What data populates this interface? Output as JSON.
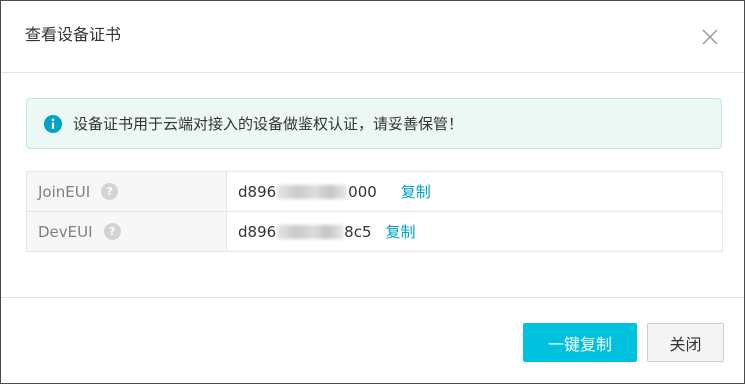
{
  "dialog": {
    "title": "查看设备证书",
    "close_icon": "close-icon"
  },
  "alert": {
    "icon": "info-icon",
    "text": "设备证书用于云端对接入的设备做鉴权认证，请妥善保管！",
    "bg_color": "#ebf8f3",
    "icon_color": "#00a2ca"
  },
  "table": {
    "rows": [
      {
        "label": "JoinEUI",
        "help_icon": "question-icon",
        "value_prefix": "d896",
        "value_suffix": "000",
        "copy_label": "复制"
      },
      {
        "label": "DevEUI",
        "help_icon": "question-icon",
        "value_prefix": "d896",
        "value_suffix": "8c5",
        "copy_label": "复制"
      }
    ]
  },
  "footer": {
    "primary_label": "一键复制",
    "close_label": "关闭",
    "primary_color": "#00c1de"
  }
}
